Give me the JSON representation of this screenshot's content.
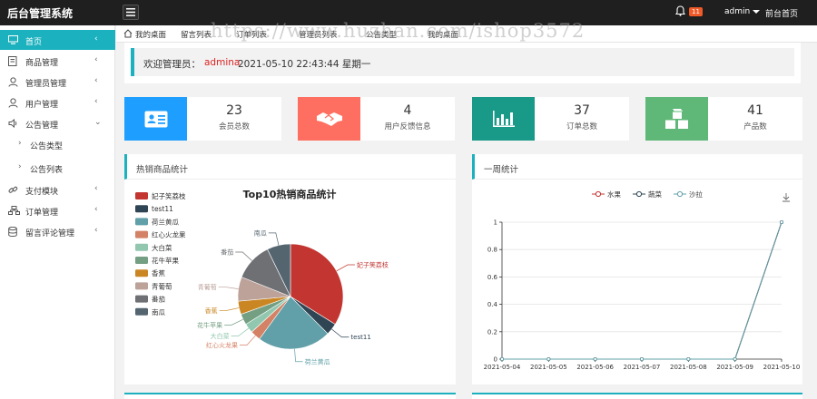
{
  "app": {
    "title": "后台管理系统"
  },
  "header": {
    "notification_count": "11",
    "user": "admin",
    "home_link": "前台首页"
  },
  "sidebar": {
    "items": [
      {
        "label": "首页",
        "icon": "monitor-icon",
        "active": true
      },
      {
        "label": "商品管理",
        "icon": "document-icon"
      },
      {
        "label": "管理员管理",
        "icon": "user-icon"
      },
      {
        "label": "用户管理",
        "icon": "user-icon"
      },
      {
        "label": "公告管理",
        "icon": "speaker-icon"
      },
      {
        "label": "公告类型",
        "icon": "chevron-right-icon"
      },
      {
        "label": "公告列表",
        "icon": "chevron-right-icon"
      },
      {
        "label": "支付模块",
        "icon": "link-icon"
      },
      {
        "label": "订单管理",
        "icon": "sitemap-icon"
      },
      {
        "label": "留言评论管理",
        "icon": "database-icon"
      }
    ]
  },
  "tabs": [
    "我的桌面",
    "留言列表",
    "订单列表",
    "管理员列表",
    "公告类型",
    "我的桌面"
  ],
  "watermark": "https://www.huzhan.com/ishop3572",
  "welcome": {
    "prefix": "欢迎管理员：",
    "user": "admina",
    "datetime": "2021-05-10  22:43:44  星期一"
  },
  "stats": [
    {
      "value": "23",
      "label": "会员总数",
      "color": "#1e9fff",
      "icon": "id-card-icon"
    },
    {
      "value": "4",
      "label": "用户反馈信息",
      "color": "#ff6f61",
      "icon": "handshake-icon"
    },
    {
      "value": "37",
      "label": "订单总数",
      "color": "#199988",
      "icon": "bar-chart-icon"
    },
    {
      "value": "41",
      "label": "产品数",
      "color": "#5fb878",
      "icon": "cubes-icon"
    }
  ],
  "panels": {
    "hot_title": "热销商品统计",
    "week_title": "一周统计"
  },
  "chart_data": [
    {
      "type": "pie",
      "title": "Top10热销商品统计",
      "legend_position": "top-left",
      "slices": [
        {
          "name": "妃子笑荔枝",
          "value": 15,
          "color": "#c23531"
        },
        {
          "name": "test11",
          "value": 1.6,
          "color": "#2f4554"
        },
        {
          "name": "荷兰黄瓜",
          "value": 10,
          "color": "#61a0a8"
        },
        {
          "name": "红心火龙果",
          "value": 1.4,
          "color": "#d48265"
        },
        {
          "name": "大白菜",
          "value": 1.3,
          "color": "#91c7ae"
        },
        {
          "name": "花牛苹果",
          "value": 1.5,
          "color": "#749f83"
        },
        {
          "name": "香蕉",
          "value": 1.8,
          "color": "#ca8622"
        },
        {
          "name": "青葡萄",
          "value": 3.3,
          "color": "#bda29a"
        },
        {
          "name": "番茄",
          "value": 5.2,
          "color": "#6e7074"
        },
        {
          "name": "南瓜",
          "value": 3.2,
          "color": "#546570"
        }
      ]
    },
    {
      "type": "line",
      "legend_position": "top-center",
      "x": [
        "2021-05-04",
        "2021-05-05",
        "2021-05-06",
        "2021-05-07",
        "2021-05-08",
        "2021-05-09",
        "2021-05-10"
      ],
      "ylim": [
        0,
        1
      ],
      "yticks": [
        "0",
        "0.2",
        "0.4",
        "0.6",
        "0.8",
        "1"
      ],
      "series": [
        {
          "name": "水果",
          "values": [
            0,
            0,
            0,
            0,
            0,
            0,
            1
          ],
          "color": "#c23531"
        },
        {
          "name": "蔬菜",
          "values": [
            0,
            0,
            0,
            0,
            0,
            0,
            1
          ],
          "color": "#2f4554"
        },
        {
          "name": "沙拉",
          "values": [
            0,
            0,
            0,
            0,
            0,
            0,
            1
          ],
          "color": "#61a0a8"
        }
      ]
    }
  ]
}
